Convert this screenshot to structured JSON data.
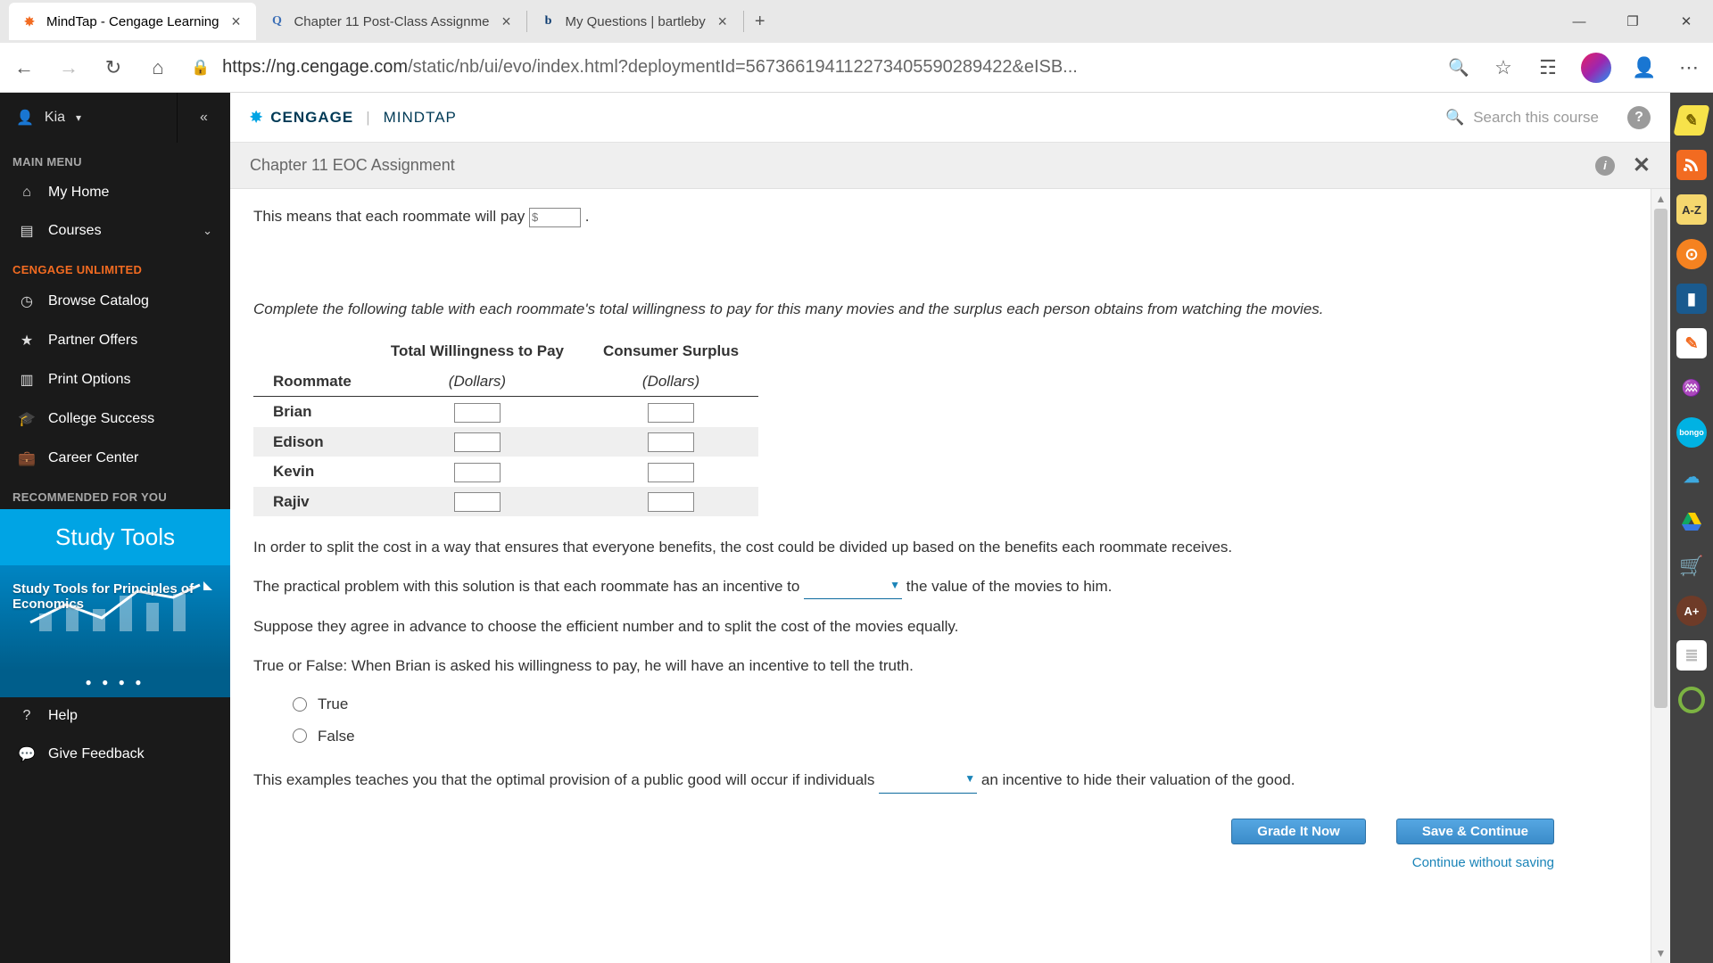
{
  "browser": {
    "tabs": [
      {
        "title": "MindTap - Cengage Learning",
        "letter": "✱"
      },
      {
        "title": "Chapter 11 Post-Class Assignme",
        "letter": "Q"
      },
      {
        "title": "My Questions | bartleby",
        "letter": "b"
      }
    ],
    "url_host": "https://ng.cengage.com",
    "url_path": "/static/nb/ui/evo/index.html?deploymentId=567366194112273405590289422&eISB..."
  },
  "sidebar": {
    "user": "Kia",
    "sections": {
      "main": "MAIN MENU",
      "unlimited": "CENGAGE UNLIMITED",
      "rec": "RECOMMENDED FOR YOU"
    },
    "main_items": {
      "home": "My Home",
      "courses": "Courses"
    },
    "unl_items": {
      "browse": "Browse Catalog",
      "partner": "Partner Offers",
      "print": "Print Options",
      "college": "College Success",
      "career": "Career Center"
    },
    "promo": {
      "title": "Study Tools",
      "line": "Study Tools for Principles of Economics"
    },
    "footer": {
      "help": "Help",
      "feedback": "Give Feedback"
    }
  },
  "brand": {
    "cengage": "CENGAGE",
    "mindtap": "MINDTAP",
    "search": "Search this course"
  },
  "assign": {
    "title": "Chapter 11 EOC Assignment",
    "line1_a": "This means that each roommate will pay ",
    "line1_b": " .",
    "input_placeholder": "$",
    "para2": "Complete the following table with each roommate's total willingness to pay for this many movies and the surplus each person obtains from watching the movies.",
    "table": {
      "h1": "Roommate",
      "h2": "Total Willingness to Pay",
      "h3": "Consumer Surplus",
      "unit": "(Dollars)",
      "rows": [
        "Brian",
        "Edison",
        "Kevin",
        "Rajiv"
      ]
    },
    "para3": "In order to split the cost in a way that ensures that everyone benefits, the cost could be divided up based on the benefits each roommate receives.",
    "para4_a": "The practical problem with this solution is that each roommate has an incentive to ",
    "para4_b": " the value of the movies to him.",
    "para5": "Suppose they agree in advance to choose the efficient number and to split the cost of the movies equally.",
    "para6": "True or False: When Brian is asked his willingness to pay, he will have an incentive to tell the truth.",
    "opt_true": "True",
    "opt_false": "False",
    "para7_a": "This examples teaches you that the optimal provision of a public good will occur if individuals ",
    "para7_b": " an incentive to hide their valuation of the good.",
    "btn_grade": "Grade It Now",
    "btn_save": "Save & Continue",
    "link_cont": "Continue without saving"
  }
}
